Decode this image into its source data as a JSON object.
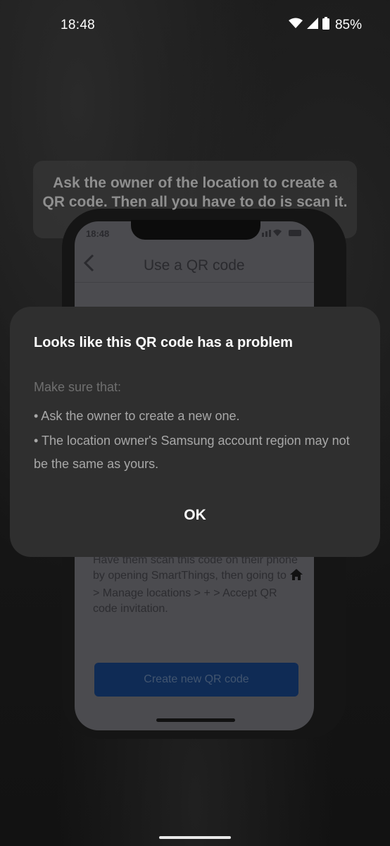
{
  "status_bar": {
    "time": "18:48",
    "battery": "85%",
    "icons": [
      "wifi-icon",
      "signal-icon",
      "battery-icon"
    ]
  },
  "hint": {
    "text": "Ask the owner of the location to create a QR code. Then all you have to do is scan it."
  },
  "phone_photo": {
    "time": "18:48",
    "nav_title": "Use a QR code",
    "instructions_part1": "Have them scan this code on their phone by opening SmartThings, then going to",
    "instructions_part2": "> Manage locations > + > Accept QR code invitation.",
    "button_label": "Create new QR code"
  },
  "dialog": {
    "title": "Looks like this QR code has a problem",
    "subtitle": "Make sure that:",
    "bullets": [
      "• Ask the owner to create a new one.",
      "• The location owner's Samsung account region may not be the same as yours."
    ],
    "ok_label": "OK"
  },
  "colors": {
    "dialog_bg": "#2f2f2f",
    "phone_button": "#0f2b55"
  }
}
